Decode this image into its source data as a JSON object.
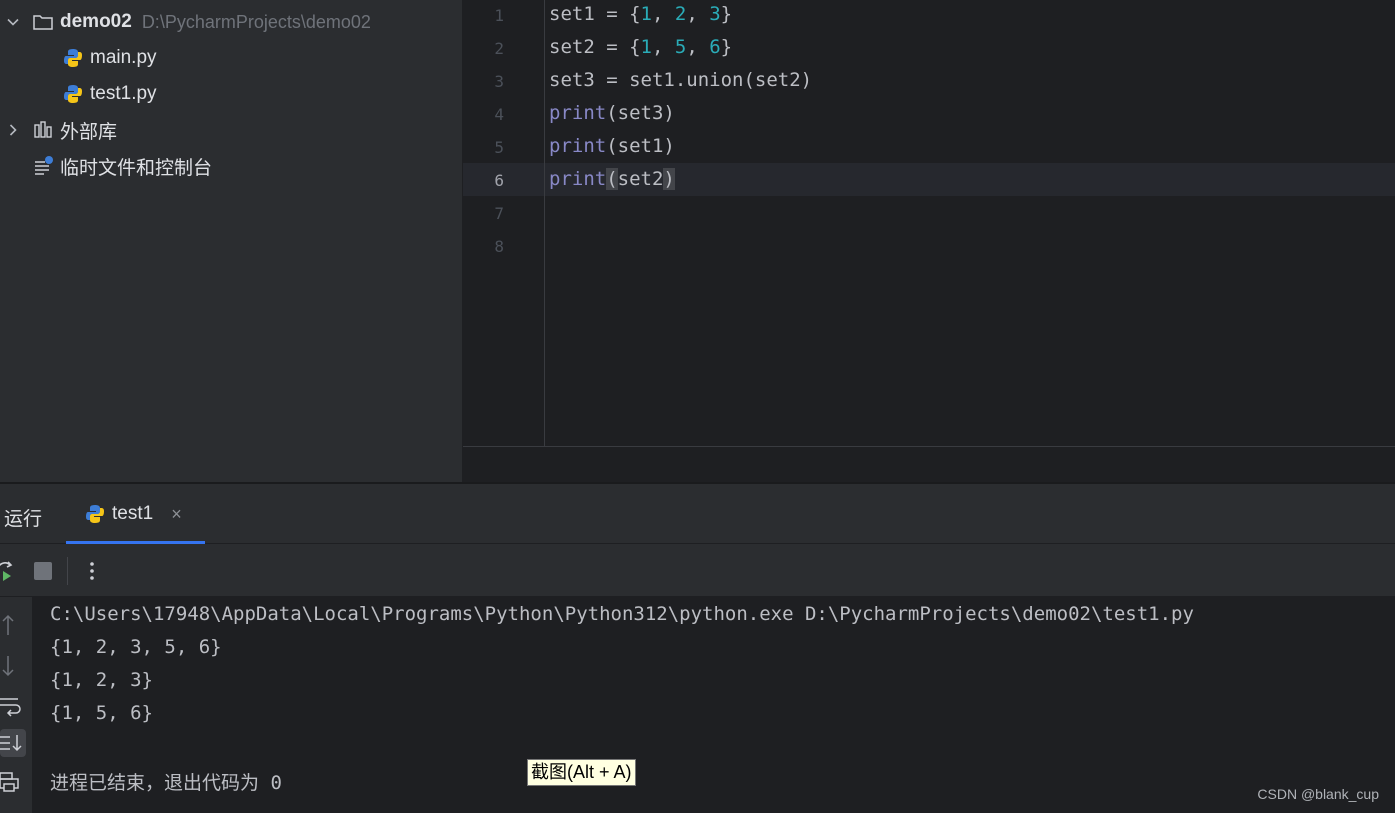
{
  "project_tree": {
    "root": {
      "name": "demo02",
      "path": "D:\\PycharmProjects\\demo02"
    },
    "files": [
      {
        "name": "main.py",
        "icon": "python-file-icon"
      },
      {
        "name": "test1.py",
        "icon": "python-file-icon"
      }
    ],
    "external_libraries": "外部库",
    "scratches": "临时文件和控制台"
  },
  "editor": {
    "current_line": 6,
    "line_numbers": [
      "1",
      "2",
      "3",
      "4",
      "5",
      "6",
      "7",
      "8"
    ],
    "code": {
      "l1": {
        "a": "set1 = {",
        "n1": "1",
        "s1": ", ",
        "n2": "2",
        "s2": ", ",
        "n3": "3",
        "e": "}"
      },
      "l2": {
        "a": "set2 = {",
        "n1": "1",
        "s1": ", ",
        "n2": "5",
        "s2": ", ",
        "n3": "6",
        "e": "}"
      },
      "l3": "set3 = set1.union(set2)",
      "l4": {
        "kw": "print",
        "rest": "(set3)"
      },
      "l5": {
        "kw": "print",
        "rest": "(set1)"
      },
      "l6": {
        "kw": "print",
        "open": "(",
        "arg": "set2",
        "close": ")"
      }
    }
  },
  "run_panel": {
    "title": "运行",
    "tab": {
      "label": "test1",
      "close": "×"
    },
    "output": [
      "C:\\Users\\17948\\AppData\\Local\\Programs\\Python\\Python312\\python.exe D:\\PycharmProjects\\demo02\\test1.py",
      "{1, 2, 3, 5, 6}",
      "{1, 2, 3}",
      "{1, 5, 6}",
      "",
      "进程已结束，退出代码为 0"
    ]
  },
  "tooltip": "截图(Alt + A)",
  "watermark": "CSDN @blank_cup",
  "colors": {
    "accent": "#3574f0",
    "keyword": "#8888c6",
    "number": "#2aacb8",
    "run_green": "#5fb865"
  }
}
